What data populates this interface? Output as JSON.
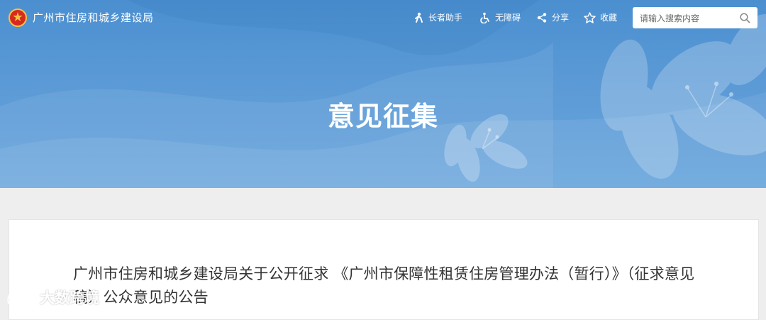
{
  "header": {
    "site_title": "广州市住房和城乡建设局",
    "tools": {
      "elder": "长者助手",
      "accessibility": "无障碍",
      "share": "分享",
      "favorite": "收藏"
    },
    "search": {
      "placeholder": "请输入搜索内容"
    },
    "page_title": "意见征集"
  },
  "notice": {
    "title": "广州市住房和城乡建设局关于公开征求 《广州市保障性租赁住房管理办法（暂行）》（征求意见稿）公众意见的公告"
  },
  "watermark": {
    "text": "大数跨境"
  },
  "colors": {
    "header_blue": "#5b9ad6",
    "card_bg": "#ffffff",
    "page_bg": "#eeeeee"
  },
  "icons": [
    "emblem-icon",
    "elder-helper-icon",
    "wheelchair-icon",
    "share-icon",
    "star-icon",
    "search-icon",
    "watermark-logo-icon"
  ]
}
